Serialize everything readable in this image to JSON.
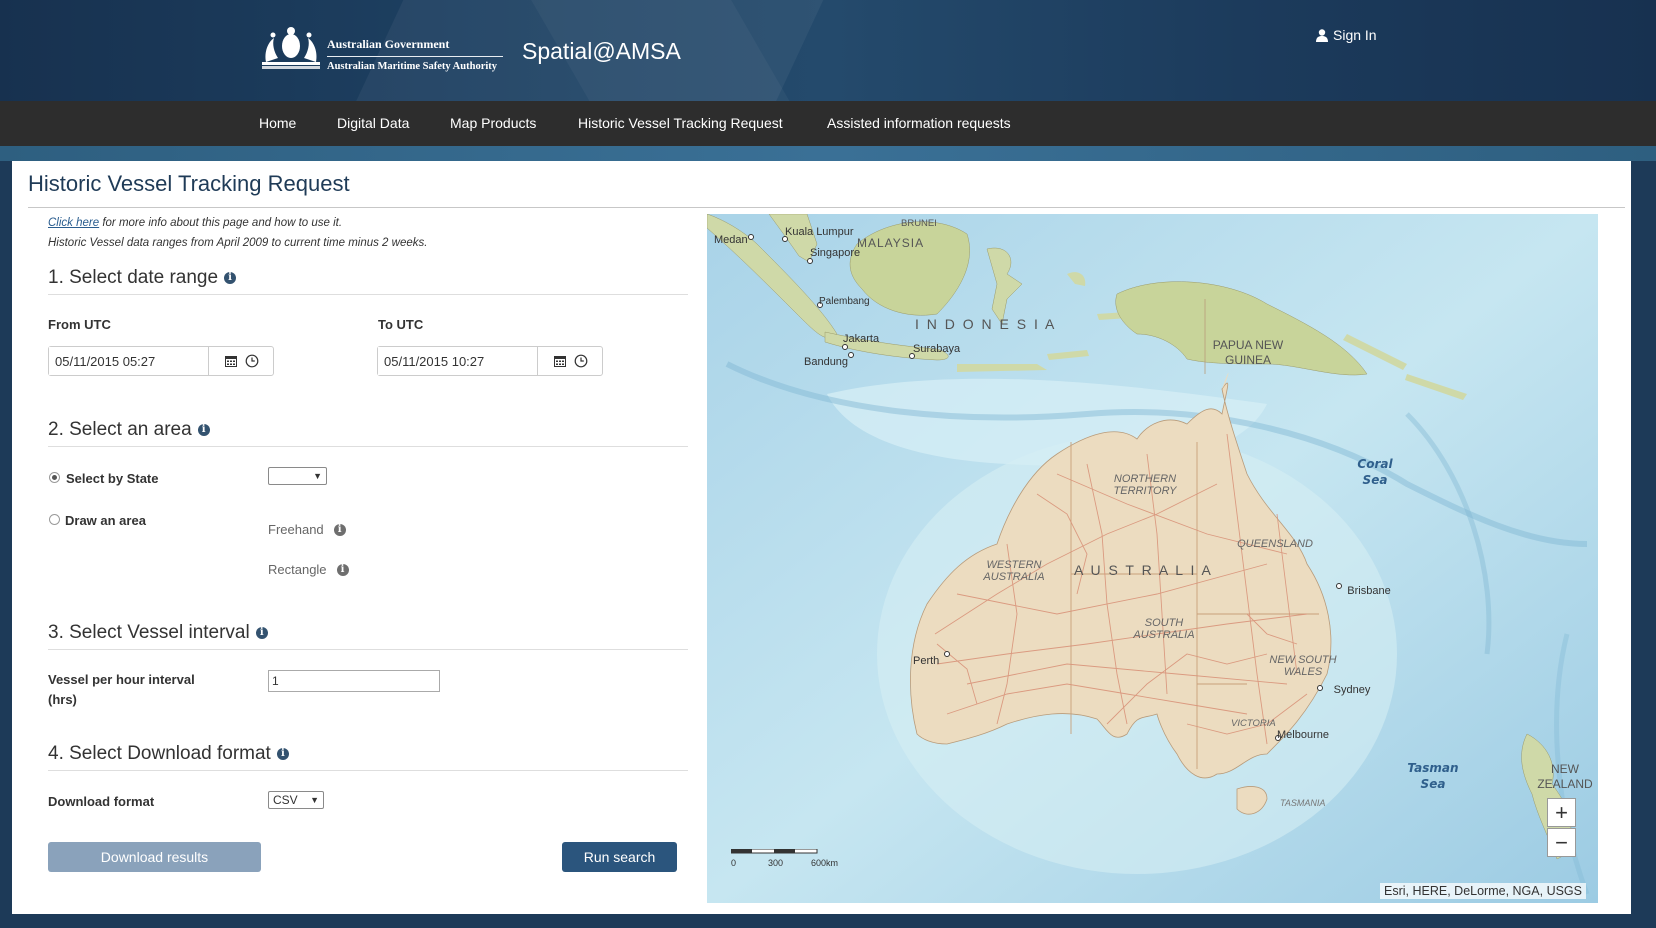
{
  "header": {
    "gov_line1": "Australian Government",
    "gov_line2": "Australian Maritime Safety Authority",
    "app_title": "Spatial@AMSA",
    "sign_in": "Sign In"
  },
  "nav": {
    "items": [
      "Home",
      "Digital Data",
      "Map Products",
      "Historic Vessel Tracking Request",
      "Assisted information requests"
    ]
  },
  "page": {
    "title": "Historic Vessel Tracking Request",
    "info_link": "Click here",
    "info_text": " for more info about this page and how to use it.",
    "range_note": "Historic Vessel data ranges from April 2009 to current time minus 2 weeks."
  },
  "form": {
    "section1_title": "1. Select date range",
    "from_label": "From UTC",
    "from_value": "05/11/2015 05:27",
    "to_label": "To UTC",
    "to_value": "05/11/2015 10:27",
    "section2_title": "2. Select an area",
    "select_by_state": "Select by State",
    "state_value": "",
    "draw_area": "Draw an area",
    "freehand": "Freehand",
    "rectangle": "Rectangle",
    "section3_title": "3. Select Vessel interval",
    "interval_label_1": "Vessel per hour interval",
    "interval_label_2": "(hrs)",
    "interval_value": "1",
    "section4_title": "4. Select Download format",
    "format_label": "Download format",
    "format_value": "CSV",
    "download_button": "Download results",
    "run_button": "Run search"
  },
  "map": {
    "attribution": "Esri, HERE, DeLorme, NGA, USGS",
    "scale_labels": [
      "0",
      "300",
      "600km"
    ],
    "zoom_in": "+",
    "zoom_out": "−",
    "labels": {
      "medan": "Medan",
      "kuala_lumpur": "Kuala Lumpur",
      "brunei": "BRUNEI",
      "malaysia": "MALAYSIA",
      "singapore": "Singapore",
      "palembang": "Palembang",
      "indonesia": "I N D O N E S I A",
      "jakarta": "Jakarta",
      "surabaya": "Surabaya",
      "bandung": "Bandung",
      "papua_1": "PAPUA NEW",
      "papua_2": "GUINEA",
      "coral_1": "Coral",
      "coral_2": "Sea",
      "nt_1": "NORTHERN",
      "nt_2": "TERRITORY",
      "qld": "QUEENSLAND",
      "wa_1": "WESTERN",
      "wa_2": "AUSTRALIA",
      "australia": "A U S T R A L I A",
      "sa_1": "SOUTH",
      "sa_2": "AUSTRALIA",
      "brisbane": "Brisbane",
      "perth": "Perth",
      "nsw_1": "NEW SOUTH",
      "nsw_2": "WALES",
      "sydney": "Sydney",
      "victoria": "VICTORIA",
      "melbourne": "Melbourne",
      "tasman_1": "Tasman",
      "tasman_2": "Sea",
      "tasmania": "TASMANIA",
      "nz_1": "NEW",
      "nz_2": "ZEALAND"
    }
  },
  "colors": {
    "header_bg": "#1f4466",
    "nav_bg": "#2d2d2d",
    "title_color": "#1f3b57",
    "primary_button": "#2b557d",
    "disabled_button": "#8aa2bb",
    "ocean": "#bfe2ef",
    "land": "#ecdcc0",
    "roads": "#d9937a"
  },
  "icons": [
    "user-icon",
    "calendar-icon",
    "clock-icon",
    "info-icon",
    "crest-icon"
  ]
}
